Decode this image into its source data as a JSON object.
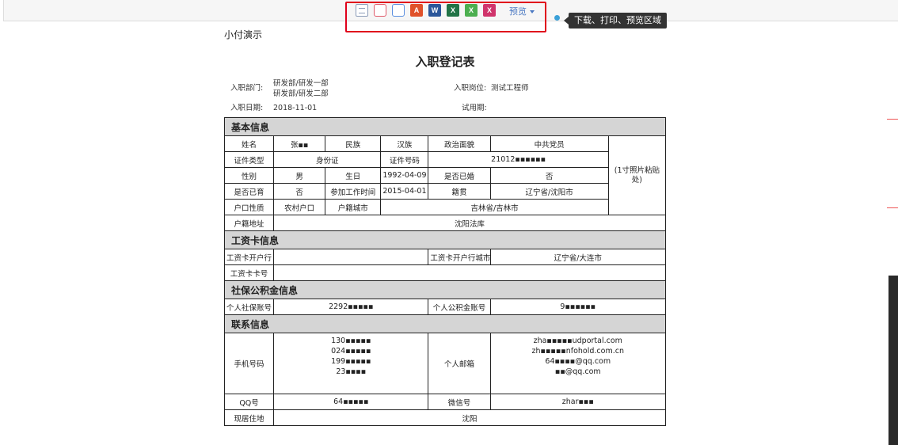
{
  "toolbar": {
    "icons": [
      "text-file-icon",
      "printer-icon",
      "printer-alt-icon",
      "pdf-icon",
      "word-icon",
      "excel-icon",
      "excel-alt-icon",
      "excel-pink-icon"
    ],
    "preview_label": "预览",
    "tooltip": "下载、打印、预览区域",
    "accent_color": "#e0001b"
  },
  "page": {
    "company": "小付演示",
    "title": "入职登记表",
    "dept_label": "入职部门:",
    "dept_value_1": "研发部/研发一部",
    "dept_value_2": "研发部/研发二部",
    "position_label": "入职岗位:",
    "position_value": "测试工程师",
    "date_label": "入职日期:",
    "date_value": "2018-11-01",
    "probation_label": "试用期:"
  },
  "sections": {
    "basic": "基本信息",
    "salary": "工资卡信息",
    "social": "社保公积金信息",
    "contact": "联系信息"
  },
  "basic": {
    "name_label": "姓名",
    "name_value": "张▪▪",
    "ethnic_label": "民族",
    "ethnic_value": "汉族",
    "political_label": "政治面貌",
    "political_value": "中共党员",
    "photo": "(1寸照片粘贴处)",
    "idtype_label": "证件类型",
    "idtype_value": "身份证",
    "idnum_label": "证件号码",
    "idnum_value": "21012▪▪▪▪▪▪",
    "gender_label": "性别",
    "gender_value": "男",
    "birth_label": "生日",
    "birth_value": "1992-04-09",
    "married_label": "是否已婚",
    "married_value": "否",
    "children_label": "是否已育",
    "children_value": "否",
    "work_label": "参加工作时间",
    "work_value": "2015-04-01",
    "native_label": "籍贯",
    "native_value": "辽宁省/沈阳市",
    "hukou_label": "户口性质",
    "hukou_value": "农村户口",
    "hukoucity_label": "户籍城市",
    "hukoucity_value": "吉林省/吉林市",
    "hukouaddr_label": "户籍地址",
    "hukouaddr_value": "沈阳法库"
  },
  "salary": {
    "bank_label": "工资卡开户行",
    "bank_value": "",
    "bankcity_label": "工资卡开户行城市",
    "bankcity_value": "辽宁省/大连市",
    "card_label": "工资卡卡号",
    "card_value": ""
  },
  "social": {
    "ss_label": "个人社保账号",
    "ss_value": "2292▪▪▪▪▪",
    "hf_label": "个人公积金账号",
    "hf_value": "9▪▪▪▪▪▪"
  },
  "contact": {
    "phone_label": "手机号码",
    "phones": [
      "130▪▪▪▪▪",
      "024▪▪▪▪▪",
      "199▪▪▪▪▪",
      "23▪▪▪▪"
    ],
    "email_label": "个人邮箱",
    "emails": [
      "zha▪▪▪▪▪udportal.com",
      "zh▪▪▪▪▪nfohold.com.cn",
      "64▪▪▪▪@qq.com",
      "▪▪@qq.com"
    ],
    "qq_label": "QQ号",
    "qq_value": "64▪▪▪▪▪",
    "wechat_label": "微信号",
    "wechat_value": "zhar▪▪▪",
    "address_label": "现居住地",
    "address_value": "沈阳"
  }
}
